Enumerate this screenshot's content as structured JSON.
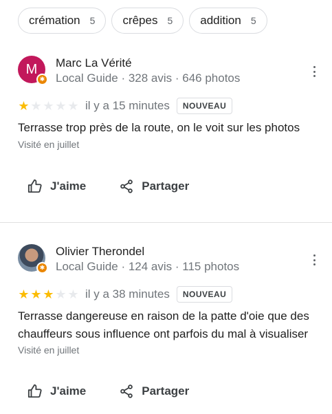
{
  "filters": [
    {
      "label": "crémation",
      "count": "5"
    },
    {
      "label": "crêpes",
      "count": "5"
    },
    {
      "label": "addition",
      "count": "5"
    }
  ],
  "reviews": [
    {
      "avatar_letter": "M",
      "name": "Marc La Vérité",
      "meta": "Local Guide · 328 avis · 646 photos",
      "rating": 1,
      "time": "il y a 15 minutes",
      "badge": "NOUVEAU",
      "text": "Terrasse trop près de la route, on le voit sur les photos",
      "visit": "Visité en juillet"
    },
    {
      "avatar_letter": "",
      "name": "Olivier Therondel",
      "meta": "Local Guide · 124 avis · 115 photos",
      "rating": 3,
      "time": "il y a 38 minutes",
      "badge": "NOUVEAU",
      "text": "Terrasse dangereuse en raison de la patte d'oie que des chauffeurs sous influence ont parfois du mal à visualiser",
      "visit": "Visité en juillet"
    }
  ],
  "actions": {
    "like": "J'aime",
    "share": "Partager"
  },
  "colors": {
    "star": "#fbbc04",
    "avatar_m": "#c2185b",
    "guide_badge": "#ea8600"
  },
  "icons": {
    "like": "thumb-up-icon",
    "share": "share-icon",
    "more": "more-vert-icon",
    "guide": "local-guide-badge-icon"
  }
}
